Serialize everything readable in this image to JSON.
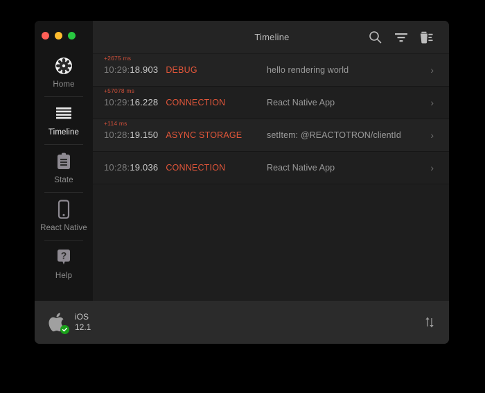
{
  "window": {
    "traffic_lights": [
      {
        "name": "close",
        "color": "#ff5f57"
      },
      {
        "name": "minimize",
        "color": "#febc2e"
      },
      {
        "name": "zoom",
        "color": "#28c840"
      }
    ]
  },
  "sidebar": {
    "items": [
      {
        "label": "Home",
        "icon": "gear-circle-icon",
        "active": false
      },
      {
        "label": "Timeline",
        "icon": "lines-icon",
        "active": true
      },
      {
        "label": "State",
        "icon": "clipboard-icon",
        "active": false
      },
      {
        "label": "React Native",
        "icon": "phone-icon",
        "active": false
      },
      {
        "label": "Help",
        "icon": "question-bubble-icon",
        "active": false
      }
    ]
  },
  "topbar": {
    "title": "Timeline",
    "actions": [
      {
        "name": "search-icon",
        "label": "Search"
      },
      {
        "name": "filter-icon",
        "label": "Filter"
      },
      {
        "name": "trash-icon",
        "label": "Clear"
      }
    ]
  },
  "timeline": {
    "rows": [
      {
        "delta": "+2675 ms",
        "time_prefix": "10:29:",
        "time_value": "18.903",
        "tag": "DEBUG",
        "message": "hello rendering world",
        "chevron": "›"
      },
      {
        "delta": "+57078 ms",
        "time_prefix": "10:29:",
        "time_value": "16.228",
        "tag": "CONNECTION",
        "message": "React Native App",
        "chevron": "›"
      },
      {
        "delta": "+114 ms",
        "time_prefix": "10:28:",
        "time_value": "19.150",
        "tag": "ASYNC STORAGE",
        "message": "setItem: @REACTOTRON/clientId",
        "chevron": "›"
      },
      {
        "delta": "",
        "time_prefix": "10:28:",
        "time_value": "19.036",
        "tag": "CONNECTION",
        "message": "React Native App",
        "chevron": "›"
      }
    ]
  },
  "statusbar": {
    "device_icon": "apple-logo-icon",
    "connected_badge": "check-icon",
    "os_name": "iOS",
    "os_version": "12.1",
    "transfer_icon": "arrows-up-down-icon"
  },
  "colors": {
    "accent_orange": "#e2563a",
    "delta_orange": "#d0503a",
    "window_bg": "#1e1e1e",
    "sidebar_bg": "#151515",
    "topbar_bg": "#242424",
    "statusbar_bg": "#2b2b2b",
    "connected_green": "#1aa11a"
  }
}
